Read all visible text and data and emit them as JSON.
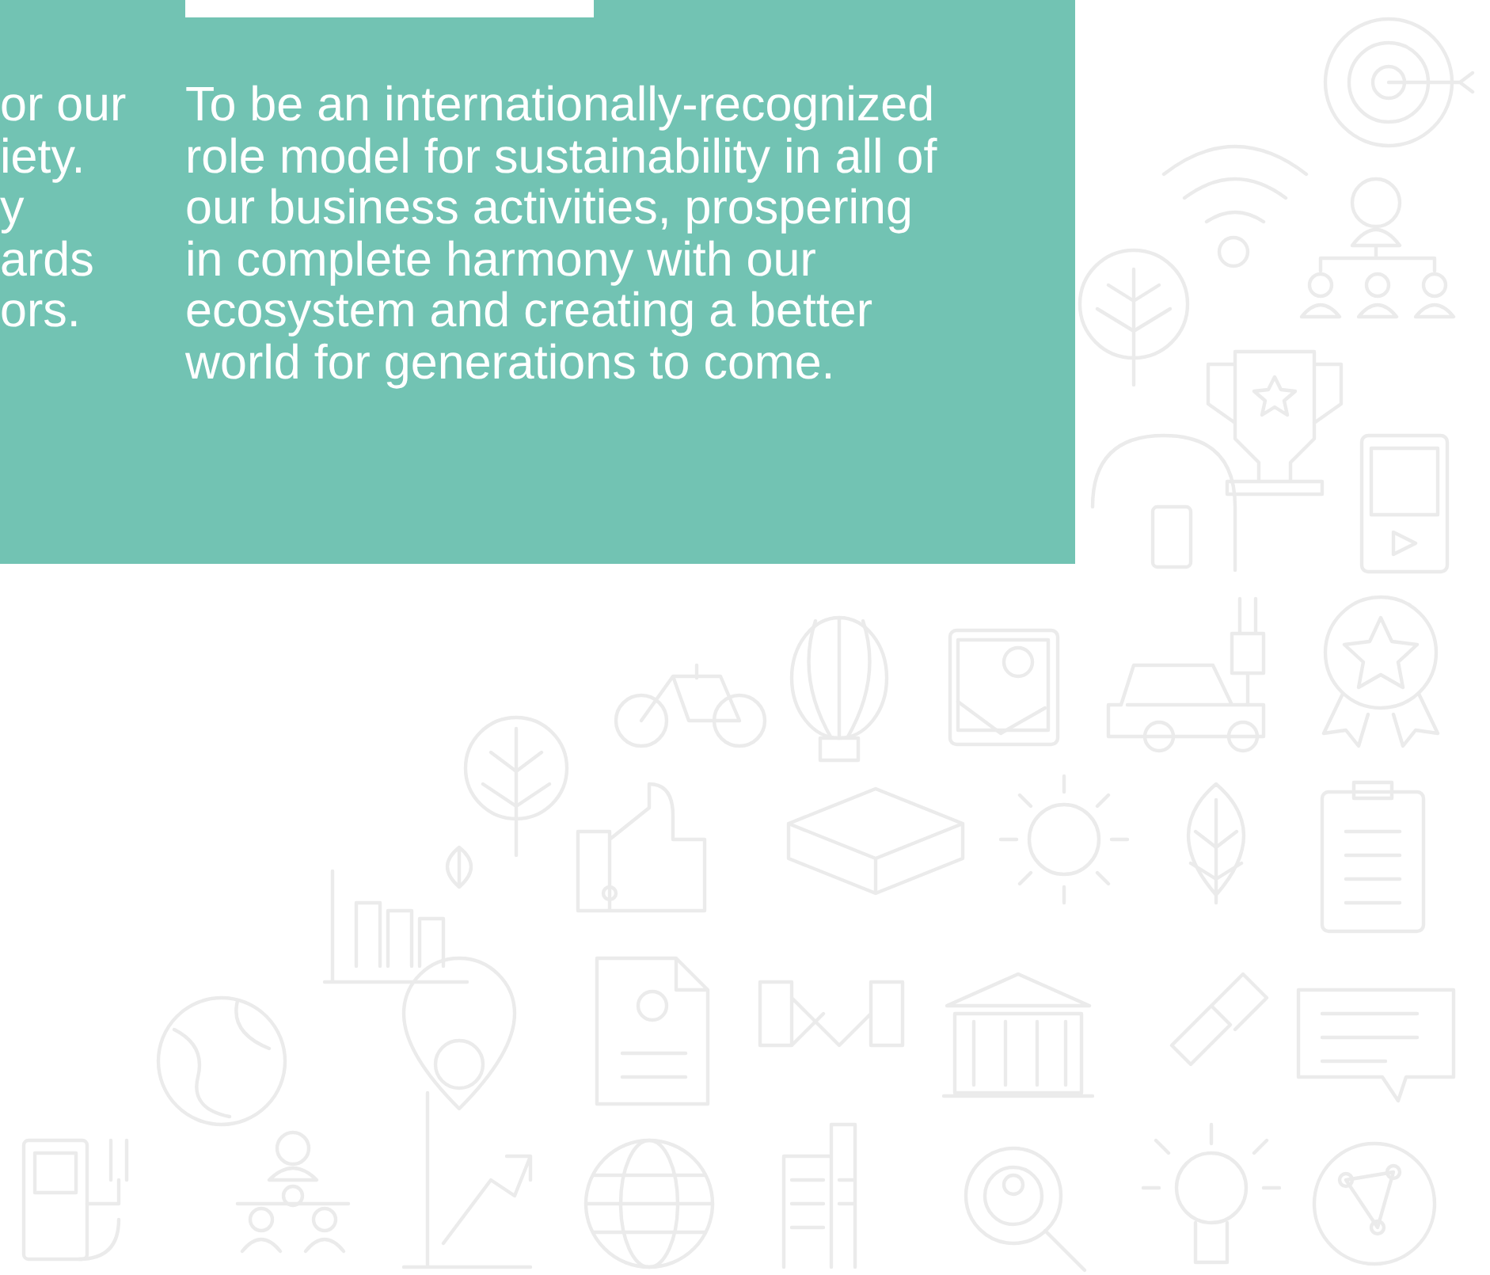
{
  "panel": {
    "left_text": {
      "lines": [
        "or our",
        "iety.",
        "y",
        "ards",
        "ors."
      ]
    },
    "right_text": {
      "lines": [
        "To be an internationally-recognized",
        "role model for sustainability in all of",
        "our business activities, prospering",
        "in complete harmony with our",
        "ecosystem and creating a better",
        "world for generations to come."
      ]
    }
  }
}
